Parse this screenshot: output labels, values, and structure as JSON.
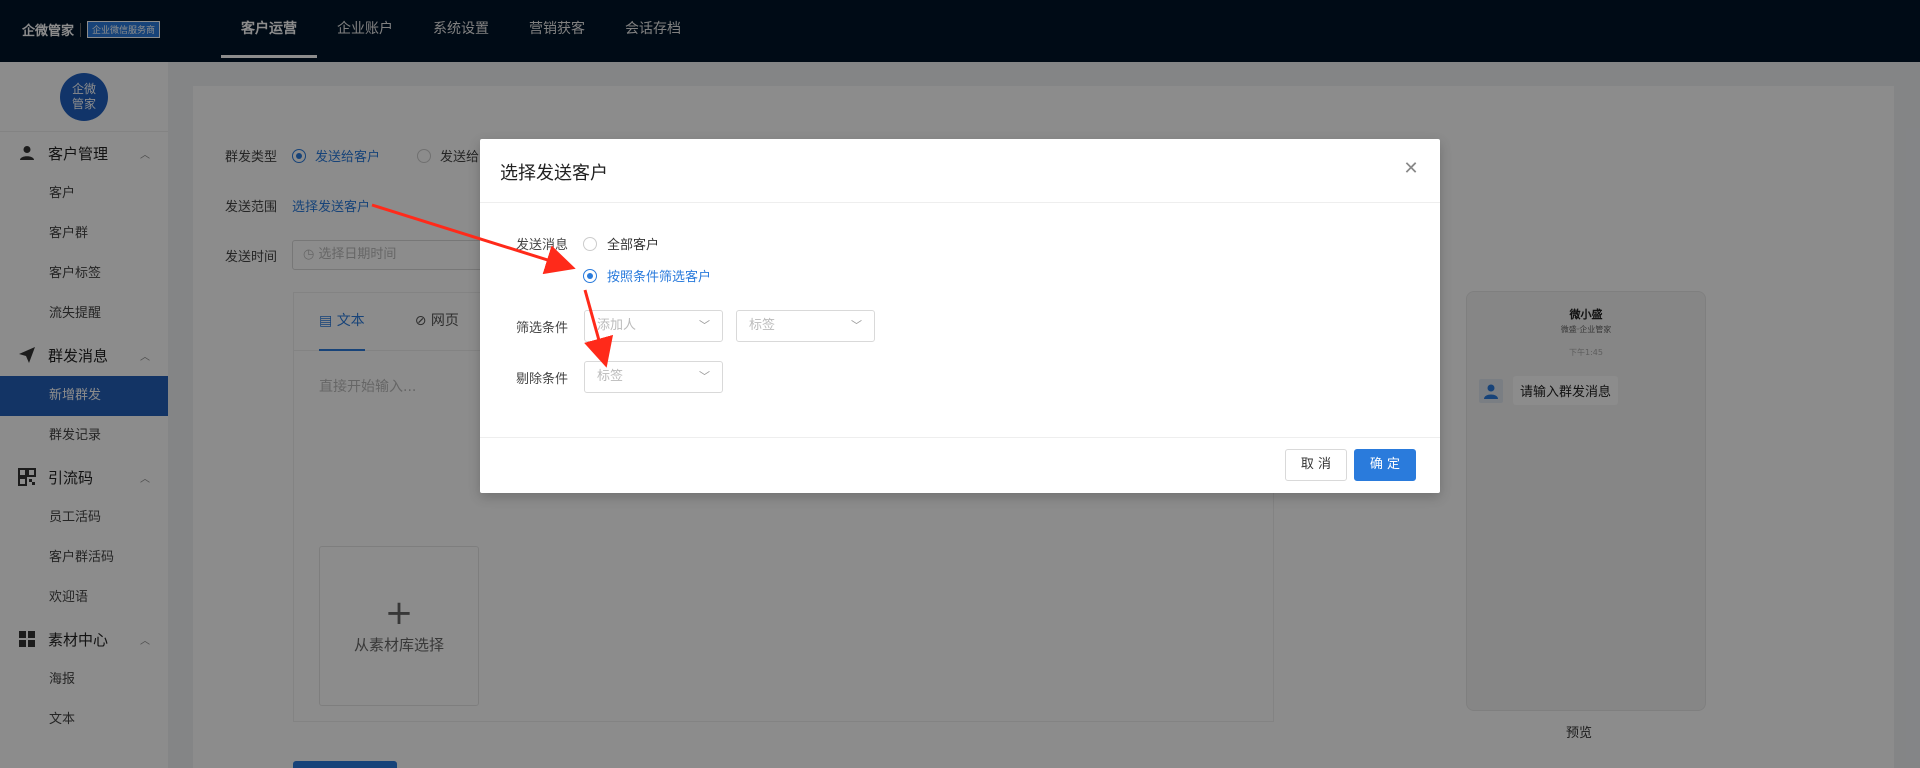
{
  "brand": {
    "name": "企微管家",
    "badge": "企业微信服务商"
  },
  "nav": {
    "items": [
      "客户运营",
      "企业账户",
      "系统设置",
      "营销获客",
      "会话存档"
    ],
    "active_index": 0
  },
  "sidebar": {
    "avatar_text": "企微\n管家",
    "groups": [
      {
        "icon": "user-icon",
        "label": "客户管理",
        "items": [
          "客户",
          "客户群",
          "客户标签",
          "流失提醒"
        ]
      },
      {
        "icon": "send-icon",
        "label": "群发消息",
        "items": [
          "新增群发",
          "群发记录"
        ],
        "active_item": 0
      },
      {
        "icon": "qrcode-icon",
        "label": "引流码",
        "items": [
          "员工活码",
          "客户群活码",
          "欢迎语"
        ]
      },
      {
        "icon": "grid-icon",
        "label": "素材中心",
        "items": [
          "海报",
          "文本"
        ]
      }
    ]
  },
  "form": {
    "type_label": "群发类型",
    "type_option_1": "发送给客户",
    "type_option_2": "发送给",
    "scope_label": "发送范围",
    "scope_link": "选择发送客户",
    "time_label": "发送时间",
    "time_placeholder": "选择日期时间"
  },
  "editor": {
    "tabs": [
      "文本",
      "网页"
    ],
    "placeholder": "直接开始输入...",
    "library_plus": "+",
    "library_label": "从素材库选择"
  },
  "preview": {
    "name": "微小盛",
    "sub": "微盛·企业管家",
    "time": "下午1:45",
    "message": "请输入群发消息",
    "label": "预览"
  },
  "modal": {
    "title": "选择发送客户",
    "send_label": "发送消息",
    "options": [
      "全部客户",
      "按照条件筛选客户"
    ],
    "selected_option": 1,
    "filter_label": "筛选条件",
    "filter_select_1": "添加人",
    "filter_select_2": "标签",
    "exclude_label": "剔除条件",
    "exclude_select": "标签",
    "cancel": "取 消",
    "ok": "确 定"
  },
  "colors": {
    "primary": "#2a7bdc",
    "nav_bg": "#001529",
    "annotation": "#ff2a1a"
  }
}
